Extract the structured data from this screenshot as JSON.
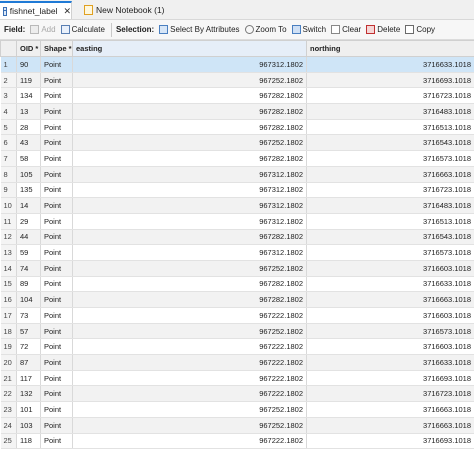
{
  "tabs": [
    {
      "label": "fishnet_label",
      "close": "✕"
    },
    {
      "label": "New Notebook (1)"
    }
  ],
  "toolbar": {
    "field_label": "Field:",
    "add_label": "Add",
    "calculate_label": "Calculate",
    "selection_label": "Selection:",
    "select_by_attributes_label": "Select By Attributes",
    "zoom_to_label": "Zoom To",
    "switch_label": "Switch",
    "clear_label": "Clear",
    "delete_label": "Delete",
    "copy_label": "Copy"
  },
  "table": {
    "columns": [
      "",
      "OID *",
      "Shape *",
      "easting",
      "northing"
    ],
    "rows": [
      [
        "1",
        "90",
        "Point",
        "967312.1802",
        "3716633.1018"
      ],
      [
        "2",
        "119",
        "Point",
        "967252.1802",
        "3716693.1018"
      ],
      [
        "3",
        "134",
        "Point",
        "967282.1802",
        "3716723.1018"
      ],
      [
        "4",
        "13",
        "Point",
        "967282.1802",
        "3716483.1018"
      ],
      [
        "5",
        "28",
        "Point",
        "967282.1802",
        "3716513.1018"
      ],
      [
        "6",
        "43",
        "Point",
        "967252.1802",
        "3716543.1018"
      ],
      [
        "7",
        "58",
        "Point",
        "967282.1802",
        "3716573.1018"
      ],
      [
        "8",
        "105",
        "Point",
        "967312.1802",
        "3716663.1018"
      ],
      [
        "9",
        "135",
        "Point",
        "967312.1802",
        "3716723.1018"
      ],
      [
        "10",
        "14",
        "Point",
        "967312.1802",
        "3716483.1018"
      ],
      [
        "11",
        "29",
        "Point",
        "967312.1802",
        "3716513.1018"
      ],
      [
        "12",
        "44",
        "Point",
        "967282.1802",
        "3716543.1018"
      ],
      [
        "13",
        "59",
        "Point",
        "967312.1802",
        "3716573.1018"
      ],
      [
        "14",
        "74",
        "Point",
        "967252.1802",
        "3716603.1018"
      ],
      [
        "15",
        "89",
        "Point",
        "967282.1802",
        "3716633.1018"
      ],
      [
        "16",
        "104",
        "Point",
        "967282.1802",
        "3716663.1018"
      ],
      [
        "17",
        "73",
        "Point",
        "967222.1802",
        "3716603.1018"
      ],
      [
        "18",
        "57",
        "Point",
        "967252.1802",
        "3716573.1018"
      ],
      [
        "19",
        "72",
        "Point",
        "967222.1802",
        "3716603.1018"
      ],
      [
        "20",
        "87",
        "Point",
        "967222.1802",
        "3716633.1018"
      ],
      [
        "21",
        "117",
        "Point",
        "967222.1802",
        "3716693.1018"
      ],
      [
        "22",
        "132",
        "Point",
        "967222.1802",
        "3716723.1018"
      ],
      [
        "23",
        "101",
        "Point",
        "967252.1802",
        "3716663.1018"
      ],
      [
        "24",
        "103",
        "Point",
        "967252.1802",
        "3716663.1018"
      ],
      [
        "25",
        "118",
        "Point",
        "967222.1802",
        "3716693.1018"
      ]
    ],
    "selected_row": 0
  }
}
